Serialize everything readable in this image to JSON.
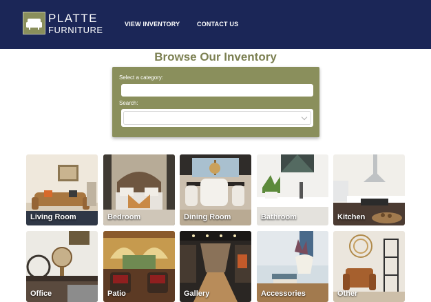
{
  "header": {
    "logo_line1": "PLATTE",
    "logo_line2": "FURNITURE",
    "nav": [
      "VIEW INVENTORY",
      "CONTACT US"
    ]
  },
  "page_title": "Browse Our Inventory",
  "filters": {
    "category_label": "Select a category:",
    "category_value": "",
    "search_label": "Search:",
    "search_value": ""
  },
  "categories": [
    {
      "label": "Living Room"
    },
    {
      "label": "Bedroom"
    },
    {
      "label": "Dining Room"
    },
    {
      "label": "Bathroom"
    },
    {
      "label": "Kitchen"
    },
    {
      "label": "Office"
    },
    {
      "label": "Patio"
    },
    {
      "label": "Gallery"
    },
    {
      "label": "Accessories"
    },
    {
      "label": "Other"
    }
  ],
  "colors": {
    "header_bg": "#1b2657",
    "accent_olive": "#8a8f5c",
    "title_color": "#7c8052"
  }
}
